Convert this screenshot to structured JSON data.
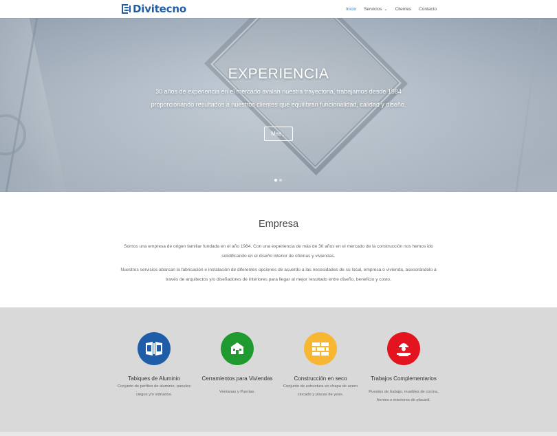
{
  "brand": {
    "name": "Divitecno",
    "color": "#1f5da8"
  },
  "nav": {
    "items": [
      {
        "label": "Inicio",
        "active": true
      },
      {
        "label": "Servicios",
        "active": false,
        "dropdown": true
      },
      {
        "label": "Clientes",
        "active": false
      },
      {
        "label": "Contacto",
        "active": false
      }
    ],
    "accent": "#2b87da"
  },
  "hero": {
    "title": "EXPERIENCIA",
    "text": "30 años de experiencia en el mercado avalan nuestra trayectoria, trabajamos desde 1984 proporcionando resultados a nuestros clientes que equilibran funcionalidad, calidad y diseño.",
    "button_label": "Mas...",
    "slides_total": 2,
    "slide_active": 1
  },
  "empresa": {
    "heading": "Empresa",
    "paragraph1": "Somos una empresa de origen familiar fundada en el año 1984. Con una experiencia de más de 30 años en el mercado de la construcción nos hemos ido solidificando en el diseño interior de oficinas y viviendas.",
    "paragraph2": "Nuestros servicios abarcan la fabricación e instalación de diferentes opciones de acuerdo a las necesidades de su local, empresa o vivienda, asesorándolo a través de arquitectos y/o diseñadores de interiores para llegar al mejor resultado entre diseño, beneficio y costo."
  },
  "services": [
    {
      "title": "Tabiques de Aluminio",
      "description": "Conjunto de perfiles de aluminio, paneles ciegos y/o vidriados.",
      "icon": "aluminum-partition-icon",
      "color": "#1f5da8"
    },
    {
      "title": "Cerramientos para Viviendas",
      "description": "Ventanas y Puertas.",
      "icon": "house-icon",
      "color": "#1e9a2e"
    },
    {
      "title": "Construcción en seco",
      "description": "Conjunto de estructura en chapa de acero cincado y placas de yeso.",
      "icon": "brick-wall-icon",
      "color": "#f7b733"
    },
    {
      "title": "Trabajos Complementarios",
      "description": "Puestos de trabajo, muebles de cocina, frentes e interiores de placard.",
      "icon": "worker-icon",
      "color": "#e3141f"
    }
  ]
}
